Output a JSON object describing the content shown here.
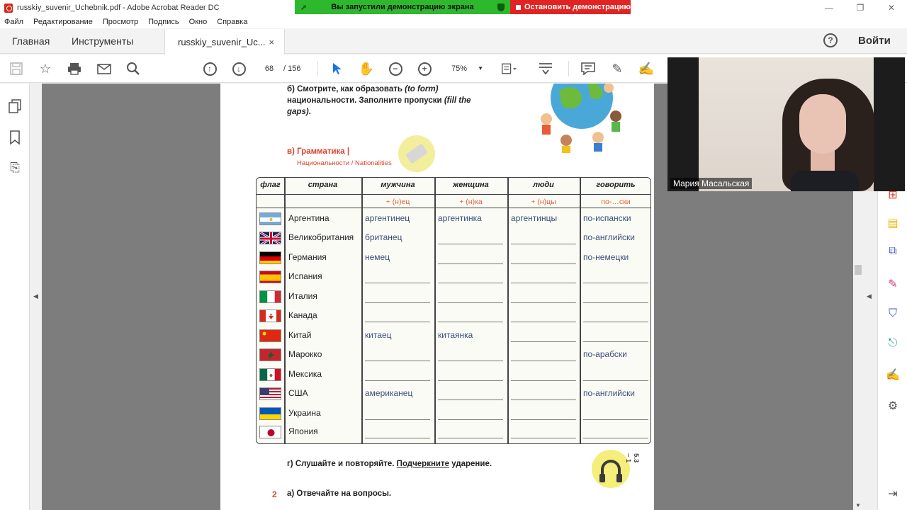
{
  "window": {
    "title": "russkiy_suvenir_Uchebnik.pdf - Adobe Acrobat Reader DC",
    "controls": [
      "—",
      "❐",
      "✕"
    ]
  },
  "share_banner": {
    "message": "Вы запустили демонстрацию экрана",
    "stop_label": "Остановить демонстрацию"
  },
  "menu": [
    "Файл",
    "Редактирование",
    "Просмотр",
    "Подпись",
    "Окно",
    "Справка"
  ],
  "tabs": {
    "home": "Главная",
    "tools": "Инструменты",
    "document": "russkiy_suvenir_Uc...",
    "close": "×"
  },
  "header": {
    "help": "?",
    "signin": "Войти"
  },
  "toolbar": {
    "page_current": "68",
    "page_total": "/ 156",
    "zoom": "75%"
  },
  "page": {
    "exercise_b": {
      "prefix": "б) Смотрите, как образовать ",
      "en1": "(to form)",
      "middle": " национальности. Заполните пропуски ",
      "en2": "(fill the gaps)",
      "end": "."
    },
    "grammar": {
      "title": "в) Грамматика |",
      "subtitle": "Национальности / Nationalities"
    },
    "table": {
      "headers": [
        "флаг",
        "страна",
        "мужчина",
        "женщина",
        "люди",
        "говорить"
      ],
      "suffixes": [
        "+ (н)ец",
        "+ (н)ка",
        "+ (н)цы",
        "по-…ски"
      ],
      "rows": [
        {
          "country": "Аргентина",
          "man": "аргентинец",
          "woman": "аргентинка",
          "people": "аргентинцы",
          "speak": "по-испански"
        },
        {
          "country": "Великобритания",
          "man": "британец",
          "woman": "",
          "people": "",
          "speak": "по-английски"
        },
        {
          "country": "Германия",
          "man": "немец",
          "woman": "",
          "people": "",
          "speak": "по-немецки"
        },
        {
          "country": "Испания",
          "man": "",
          "woman": "",
          "people": "",
          "speak": ""
        },
        {
          "country": "Италия",
          "man": "",
          "woman": "",
          "people": "",
          "speak": ""
        },
        {
          "country": "Канада",
          "man": "",
          "woman": "",
          "people": "",
          "speak": ""
        },
        {
          "country": "Китай",
          "man": "китаец",
          "woman": "китаянка",
          "people": "",
          "speak": ""
        },
        {
          "country": "Марокко",
          "man": "",
          "woman": "",
          "people": "",
          "speak": "по-арабски"
        },
        {
          "country": "Мексика",
          "man": "",
          "woman": "",
          "people": "",
          "speak": ""
        },
        {
          "country": "США",
          "man": "американец",
          "woman": "",
          "people": "",
          "speak": "по-английски"
        },
        {
          "country": "Украина",
          "man": "",
          "woman": "",
          "people": "",
          "speak": ""
        },
        {
          "country": "Япония",
          "man": "",
          "woman": "",
          "people": "",
          "speak": ""
        }
      ]
    },
    "exercise_g": {
      "prefix": "г) Слушайте и повторяйте. ",
      "underlined": "Подчеркните",
      "suffix": " ударение."
    },
    "track": "5.3 – 1",
    "exercise_2": {
      "number": "2",
      "text": "а) Отвечайте на вопросы."
    }
  },
  "webcam": {
    "name": "Мария Масальская"
  },
  "colors": {
    "accent_red": "#e0422a",
    "share_green": "#2eb82e",
    "share_red": "#e02424",
    "handwriting_blue": "#3a4f7a"
  }
}
